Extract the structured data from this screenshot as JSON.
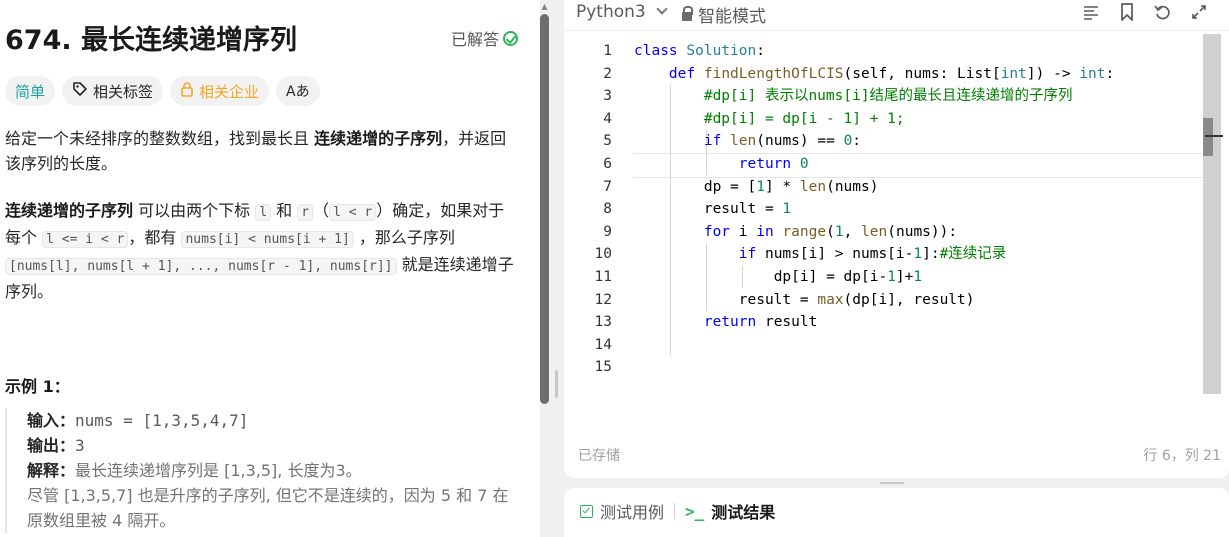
{
  "problem": {
    "title": "674. 最长连续递增序列",
    "solved_label": "已解答",
    "tags": {
      "difficulty": "简单",
      "related_tags": "相关标签",
      "related_companies": "相关企业",
      "translate": "Aあ"
    },
    "desc_p1_a": "给定一个未经排序的整数数组，找到最长且 ",
    "desc_p1_bold": "连续递增的子序列",
    "desc_p1_b": "，并返回该序列的长度。",
    "desc_p2_bold": "连续递增的子序列",
    "desc_p2_a": " 可以由两个下标 ",
    "desc_p2_l": "l",
    "desc_p2_and": " 和 ",
    "desc_p2_r": "r",
    "desc_p2_paren_open": "（",
    "desc_p2_cond": "l < r",
    "desc_p2_paren_close": "）确定，如果对于每个 ",
    "desc_p2_range": "l <= i < r",
    "desc_p2_c": "，都有 ",
    "desc_p2_ineq": "nums[i] < nums[i + 1]",
    "desc_p2_d": " ，那么子序列 ",
    "desc_p2_seq": "[nums[l], nums[l + 1], ..., nums[r - 1], nums[r]]",
    "desc_p2_e": " 就是连续递增子序列。",
    "example_title": "示例 1：",
    "example": {
      "input_label": "输入：",
      "input_value": "nums = [1,3,5,4,7]",
      "output_label": "输出：",
      "output_value": "3",
      "explain_label": "解释：",
      "explain_value": "最长连续递增序列是 [1,3,5], 长度为3。",
      "explain_more": "尽管 [1,3,5,7] 也是升序的子序列, 但它不是连续的，因为 5 和 7 在原数组里被 4 隔开。"
    }
  },
  "editor": {
    "language": "Python3",
    "mode": "智能模式",
    "saved_status": "已存储",
    "cursor_pos": "行 6，列 21",
    "line_numbers": [
      "1",
      "2",
      "3",
      "4",
      "5",
      "6",
      "7",
      "8",
      "9",
      "10",
      "11",
      "12",
      "13",
      "14",
      "15"
    ],
    "code": {
      "l1_kw": "class",
      "l1_name": "Solution",
      "l1_rest": ":",
      "l2_kw": "def",
      "l2_fn": "findLengthOfLCIS",
      "l2_a": "(self, nums: ",
      "l2_type1": "List",
      "l2_b": "[",
      "l2_type2": "int",
      "l2_c": "]) -> ",
      "l2_type3": "int",
      "l2_d": ":",
      "l3": "#dp[i] 表示以nums[i]结尾的最长且连续递增的子序列",
      "l4": "#dp[i] = dp[i - 1] + 1;",
      "l5_kw": "if",
      "l5_fn": "len",
      "l5_a": "(nums) == ",
      "l5_num": "0",
      "l5_b": ":",
      "l6_kw": "return",
      "l6_num": "0",
      "l7_a": "dp = [",
      "l7_num": "1",
      "l7_b": "] * ",
      "l7_fn": "len",
      "l7_c": "(nums)",
      "l8_a": "result = ",
      "l8_num": "1",
      "l9_kw1": "for",
      "l9_a": " i ",
      "l9_kw2": "in",
      "l9_fn": "range",
      "l9_b": "(",
      "l9_num": "1",
      "l9_c": ", ",
      "l9_fn2": "len",
      "l9_d": "(nums)):",
      "l10_kw": "if",
      "l10_a": " nums[i] > nums[i-",
      "l10_num": "1",
      "l10_b": "]:",
      "l10_cm": "#连续记录",
      "l11_a": "dp[i] = dp[i-",
      "l11_num": "1",
      "l11_b": "]+",
      "l11_num2": "1",
      "l12_a": "result = ",
      "l12_fn": "max",
      "l12_b": "(dp[i], result)",
      "l13_kw": "return",
      "l13_a": " result"
    }
  },
  "bottom": {
    "tab_testcase": "测试用例",
    "tab_result": "测试结果",
    "result_icon": ">_"
  },
  "colors": {
    "solved_green": "#2db55d",
    "easy_teal": "#1fa3a3",
    "company_orange": "#f5a623",
    "keyword_blue": "#0000ff",
    "comment_green": "#008000",
    "number_green": "#098658"
  }
}
